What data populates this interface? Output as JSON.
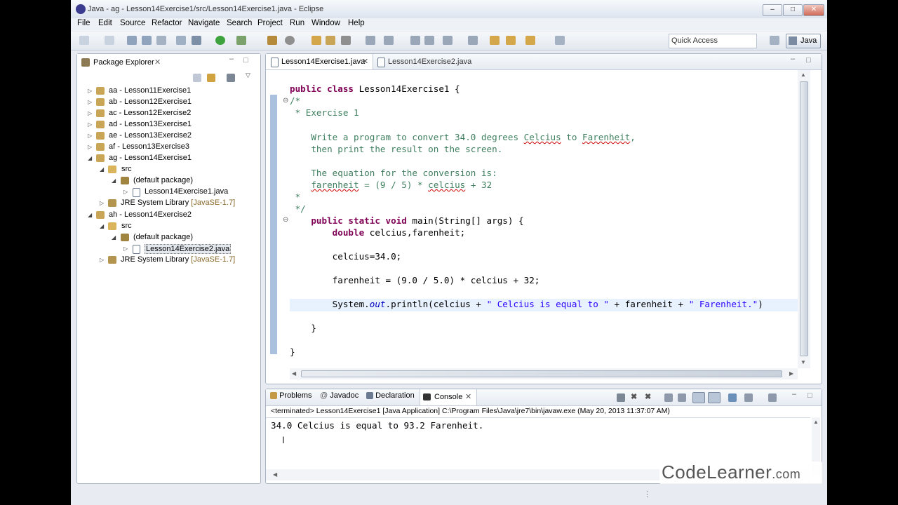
{
  "window": {
    "title": "Java - ag - Lesson14Exercise1/src/Lesson14Exercise1.java - Eclipse"
  },
  "menu": [
    "File",
    "Edit",
    "Source",
    "Refactor",
    "Navigate",
    "Search",
    "Project",
    "Run",
    "Window",
    "Help"
  ],
  "toolbar": {
    "quick_access_placeholder": "Quick Access",
    "perspective_label": "Java"
  },
  "package_explorer": {
    "title": "Package Explorer",
    "projects": [
      {
        "label": "aa - Lesson11Exercise1"
      },
      {
        "label": "ab - Lesson12Exercise1"
      },
      {
        "label": "ac - Lesson12Exercise2"
      },
      {
        "label": "ad - Lesson13Exercise1"
      },
      {
        "label": "ae - Lesson13Exercise2"
      },
      {
        "label": "af - Lesson13Exercise3"
      },
      {
        "label": "ag - Lesson14Exercise1"
      },
      {
        "label": "src"
      },
      {
        "label": "(default package)"
      },
      {
        "label": "Lesson14Exercise1.java"
      },
      {
        "label": "JRE System Library",
        "deco": "[JavaSE-1.7]"
      },
      {
        "label": "ah - Lesson14Exercise2"
      },
      {
        "label": "src"
      },
      {
        "label": "(default package)"
      },
      {
        "label": "Lesson14Exercise2.java"
      },
      {
        "label": "JRE System Library",
        "deco": "[JavaSE-1.7]"
      }
    ]
  },
  "editor": {
    "tabs": [
      "Lesson14Exercise1.java",
      "Lesson14Exercise2.java"
    ],
    "code": {
      "l1_kw": "public class",
      "l1_rest": " Lesson14Exercise1 {",
      "l2": "/*",
      "l3": " * Exercise 1",
      "l4_a": "    Write a program to convert 34.0 degrees ",
      "l4_w1": "Celcius",
      "l4_b": " to ",
      "l4_w2": "Farenheit",
      "l4_c": ",",
      "l5": "    then print the result on the screen.",
      "l6": "    The equation for the conversion is:",
      "l7_w1": "farenheit",
      "l7_b": " = (9 / 5) * ",
      "l7_w2": "celcius",
      "l7_c": " + 32",
      "l8": " *",
      "l9": " */",
      "l10_kw": "public static void",
      "l10_rest": " main(String[] args) {",
      "l11_kw": "double",
      "l11_rest": " celcius,farenheit;",
      "l12": "celcius=34.0;",
      "l13": "farenheit = (9.0 / 5.0) * celcius + 32;",
      "l14_a": "System.",
      "l14_fld": "out",
      "l14_b": ".println(celcius + ",
      "l14_s1": "\" Celcius is equal to \"",
      "l14_c": " + farenheit + ",
      "l14_s2": "\" Farenheit.\"",
      "l14_d": ")",
      "l15": "}",
      "l16": "}"
    }
  },
  "console_panel": {
    "tabs": [
      "Problems",
      "Javadoc",
      "Declaration",
      "Console"
    ],
    "status": "<terminated> Lesson14Exercise1 [Java Application] C:\\Program Files\\Java\\jre7\\bin\\javaw.exe (May 20, 2013 11:37:07 AM)",
    "output": "34.0 Celcius is equal to 93.2 Farenheit."
  },
  "watermark": {
    "name": "CodeLearner",
    "suffix": ".com"
  }
}
